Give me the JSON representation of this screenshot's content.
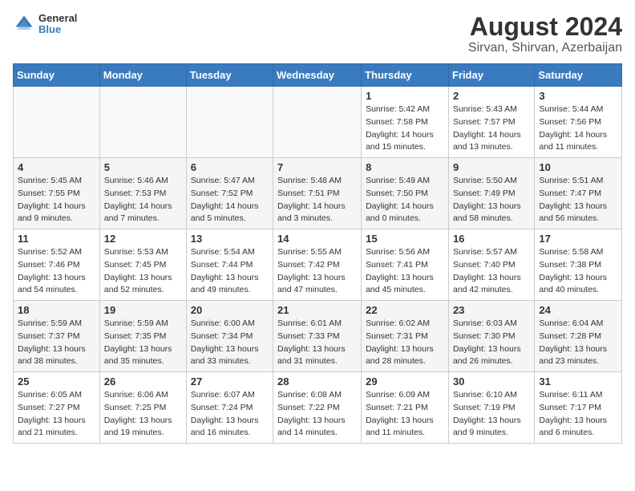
{
  "header": {
    "logo_line1": "General",
    "logo_line2": "Blue",
    "title": "August 2024",
    "subtitle": "Sirvan, Shirvan, Azerbaijan"
  },
  "days_of_week": [
    "Sunday",
    "Monday",
    "Tuesday",
    "Wednesday",
    "Thursday",
    "Friday",
    "Saturday"
  ],
  "weeks": [
    [
      {
        "day": "",
        "info": ""
      },
      {
        "day": "",
        "info": ""
      },
      {
        "day": "",
        "info": ""
      },
      {
        "day": "",
        "info": ""
      },
      {
        "day": "1",
        "info": "Sunrise: 5:42 AM\nSunset: 7:58 PM\nDaylight: 14 hours\nand 15 minutes."
      },
      {
        "day": "2",
        "info": "Sunrise: 5:43 AM\nSunset: 7:57 PM\nDaylight: 14 hours\nand 13 minutes."
      },
      {
        "day": "3",
        "info": "Sunrise: 5:44 AM\nSunset: 7:56 PM\nDaylight: 14 hours\nand 11 minutes."
      }
    ],
    [
      {
        "day": "4",
        "info": "Sunrise: 5:45 AM\nSunset: 7:55 PM\nDaylight: 14 hours\nand 9 minutes."
      },
      {
        "day": "5",
        "info": "Sunrise: 5:46 AM\nSunset: 7:53 PM\nDaylight: 14 hours\nand 7 minutes."
      },
      {
        "day": "6",
        "info": "Sunrise: 5:47 AM\nSunset: 7:52 PM\nDaylight: 14 hours\nand 5 minutes."
      },
      {
        "day": "7",
        "info": "Sunrise: 5:48 AM\nSunset: 7:51 PM\nDaylight: 14 hours\nand 3 minutes."
      },
      {
        "day": "8",
        "info": "Sunrise: 5:49 AM\nSunset: 7:50 PM\nDaylight: 14 hours\nand 0 minutes."
      },
      {
        "day": "9",
        "info": "Sunrise: 5:50 AM\nSunset: 7:49 PM\nDaylight: 13 hours\nand 58 minutes."
      },
      {
        "day": "10",
        "info": "Sunrise: 5:51 AM\nSunset: 7:47 PM\nDaylight: 13 hours\nand 56 minutes."
      }
    ],
    [
      {
        "day": "11",
        "info": "Sunrise: 5:52 AM\nSunset: 7:46 PM\nDaylight: 13 hours\nand 54 minutes."
      },
      {
        "day": "12",
        "info": "Sunrise: 5:53 AM\nSunset: 7:45 PM\nDaylight: 13 hours\nand 52 minutes."
      },
      {
        "day": "13",
        "info": "Sunrise: 5:54 AM\nSunset: 7:44 PM\nDaylight: 13 hours\nand 49 minutes."
      },
      {
        "day": "14",
        "info": "Sunrise: 5:55 AM\nSunset: 7:42 PM\nDaylight: 13 hours\nand 47 minutes."
      },
      {
        "day": "15",
        "info": "Sunrise: 5:56 AM\nSunset: 7:41 PM\nDaylight: 13 hours\nand 45 minutes."
      },
      {
        "day": "16",
        "info": "Sunrise: 5:57 AM\nSunset: 7:40 PM\nDaylight: 13 hours\nand 42 minutes."
      },
      {
        "day": "17",
        "info": "Sunrise: 5:58 AM\nSunset: 7:38 PM\nDaylight: 13 hours\nand 40 minutes."
      }
    ],
    [
      {
        "day": "18",
        "info": "Sunrise: 5:59 AM\nSunset: 7:37 PM\nDaylight: 13 hours\nand 38 minutes."
      },
      {
        "day": "19",
        "info": "Sunrise: 5:59 AM\nSunset: 7:35 PM\nDaylight: 13 hours\nand 35 minutes."
      },
      {
        "day": "20",
        "info": "Sunrise: 6:00 AM\nSunset: 7:34 PM\nDaylight: 13 hours\nand 33 minutes."
      },
      {
        "day": "21",
        "info": "Sunrise: 6:01 AM\nSunset: 7:33 PM\nDaylight: 13 hours\nand 31 minutes."
      },
      {
        "day": "22",
        "info": "Sunrise: 6:02 AM\nSunset: 7:31 PM\nDaylight: 13 hours\nand 28 minutes."
      },
      {
        "day": "23",
        "info": "Sunrise: 6:03 AM\nSunset: 7:30 PM\nDaylight: 13 hours\nand 26 minutes."
      },
      {
        "day": "24",
        "info": "Sunrise: 6:04 AM\nSunset: 7:28 PM\nDaylight: 13 hours\nand 23 minutes."
      }
    ],
    [
      {
        "day": "25",
        "info": "Sunrise: 6:05 AM\nSunset: 7:27 PM\nDaylight: 13 hours\nand 21 minutes."
      },
      {
        "day": "26",
        "info": "Sunrise: 6:06 AM\nSunset: 7:25 PM\nDaylight: 13 hours\nand 19 minutes."
      },
      {
        "day": "27",
        "info": "Sunrise: 6:07 AM\nSunset: 7:24 PM\nDaylight: 13 hours\nand 16 minutes."
      },
      {
        "day": "28",
        "info": "Sunrise: 6:08 AM\nSunset: 7:22 PM\nDaylight: 13 hours\nand 14 minutes."
      },
      {
        "day": "29",
        "info": "Sunrise: 6:09 AM\nSunset: 7:21 PM\nDaylight: 13 hours\nand 11 minutes."
      },
      {
        "day": "30",
        "info": "Sunrise: 6:10 AM\nSunset: 7:19 PM\nDaylight: 13 hours\nand 9 minutes."
      },
      {
        "day": "31",
        "info": "Sunrise: 6:11 AM\nSunset: 7:17 PM\nDaylight: 13 hours\nand 6 minutes."
      }
    ]
  ]
}
